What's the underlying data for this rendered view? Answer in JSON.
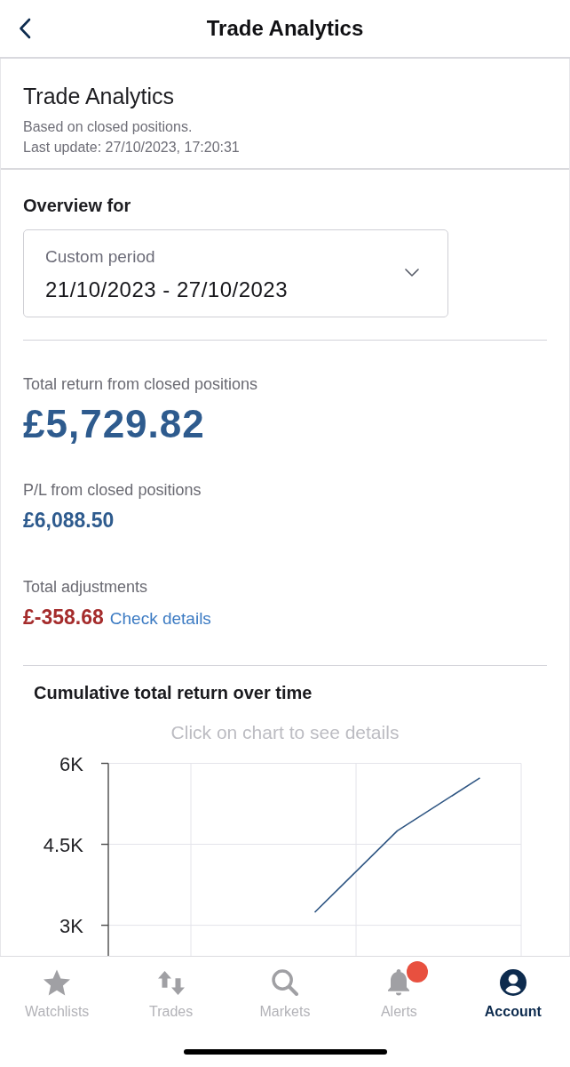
{
  "header": {
    "title": "Trade Analytics"
  },
  "summary": {
    "title": "Trade Analytics",
    "subtitle": "Based on closed positions.",
    "last_update": "Last update: 27/10/2023, 17:20:31"
  },
  "overview": {
    "label": "Overview for",
    "period": {
      "label": "Custom period",
      "value": "21/10/2023 - 27/10/2023"
    }
  },
  "metrics": [
    {
      "kind": "primary",
      "label": "Total return from closed positions",
      "value": "£5,729.82"
    },
    {
      "kind": "secondary",
      "label": "P/L from closed positions",
      "value": "£6,088.50"
    },
    {
      "kind": "negative",
      "label": "Total adjustments",
      "value": "£-358.68",
      "link": "Check details"
    }
  ],
  "chart": {
    "hint": "Click on chart to see details",
    "chart_data": {
      "type": "line",
      "title": "Cumulative total return over time",
      "categories": [
        null,
        null,
        null,
        null,
        null
      ],
      "ylim": [
        2400,
        6000
      ],
      "yticks": [
        {
          "value": 3000,
          "label": "3K"
        },
        {
          "value": 4500,
          "label": "4.5K"
        },
        {
          "value": 6000,
          "label": "6K"
        }
      ],
      "series": [
        {
          "color": "#2f5683",
          "values": [
            null,
            null,
            3240,
            4750,
            5730
          ]
        }
      ]
    }
  },
  "nav": [
    {
      "label": "Watchlists",
      "selected": false,
      "badge": false
    },
    {
      "label": "Trades",
      "selected": false,
      "badge": false
    },
    {
      "label": "Markets",
      "selected": false,
      "badge": false
    },
    {
      "label": "Alerts",
      "selected": false,
      "badge": true
    },
    {
      "label": "Account",
      "selected": true,
      "badge": false
    }
  ]
}
